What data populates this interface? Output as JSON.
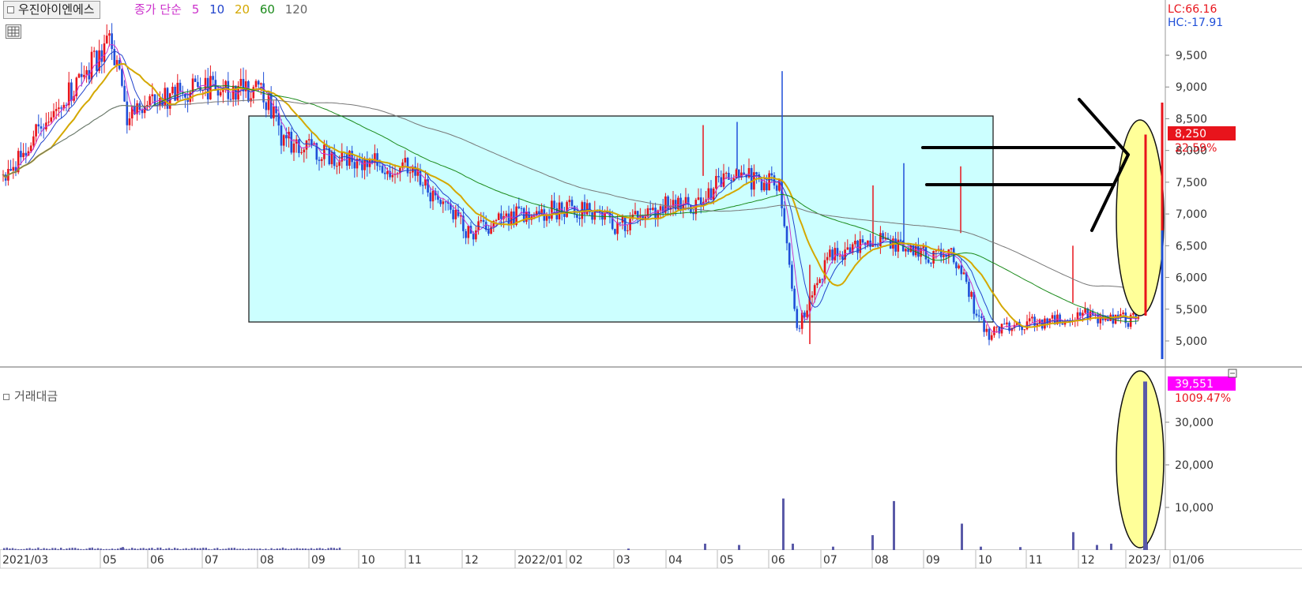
{
  "header": {
    "stock_name": "우진아이엔에스",
    "ma_label": "종가 단순",
    "ma_periods": [
      {
        "label": "5",
        "color": "#cc33cc"
      },
      {
        "label": "10",
        "color": "#2244cc"
      },
      {
        "label": "20",
        "color": "#d4a800"
      },
      {
        "label": "60",
        "color": "#1a8a1a"
      },
      {
        "label": "120",
        "color": "#666666"
      }
    ]
  },
  "price_panel": {
    "lc_label": "LC:66.16",
    "hc_label": "HC:-17.91",
    "current_price": "8,250",
    "change_pct": "22.59%"
  },
  "volume_panel": {
    "title": "거래대금",
    "current_value": "39,551",
    "change_pct": "1009.47%"
  },
  "x_axis_labels": [
    "2021/03",
    "05",
    "06",
    "07",
    "08",
    "09",
    "10",
    "11",
    "12",
    "2022/01",
    "02",
    "03",
    "04",
    "05",
    "06",
    "07",
    "08",
    "09",
    "10",
    "11",
    "12",
    "2023/",
    "01/06"
  ],
  "colors": {
    "up": "#e8141c",
    "down": "#1f4fd8",
    "box_fill": "#ccffff",
    "ellipse_fill": "#ffff99",
    "volume_bar": "#5a5aa8",
    "current_price_bg": "#e8141c",
    "volume_value_bg": "#ff00ff"
  },
  "chart_data": [
    {
      "type": "candlestick",
      "title": "우진아이엔에스",
      "y_ticks": [
        5000,
        5500,
        6000,
        6500,
        7000,
        7500,
        8000,
        8500,
        9000,
        9500
      ],
      "y_tick_labels": [
        "5,000",
        "5,500",
        "6,000",
        "6,500",
        "7,000",
        "7,500",
        "8,000",
        "8,500",
        "9,000",
        "9,500"
      ],
      "ylim": [
        4700,
        10450
      ],
      "series": [
        {
          "name": "종가",
          "points": [
            [
              "2021/03",
              7500
            ],
            [
              "2021/04",
              8700
            ],
            [
              "2021/05",
              9700
            ],
            [
              "2021/05",
              8500
            ],
            [
              "2021/06",
              8800
            ],
            [
              "2021/07",
              9000
            ],
            [
              "2021/08",
              8900
            ],
            [
              "2021/08",
              8200
            ],
            [
              "2021/09",
              8000
            ],
            [
              "2021/10",
              7800
            ],
            [
              "2021/11",
              7700
            ],
            [
              "2021/11",
              7300
            ],
            [
              "2021/12",
              6700
            ],
            [
              "2022/01",
              7000
            ],
            [
              "2022/02",
              7100
            ],
            [
              "2022/03",
              6800
            ],
            [
              "2022/04",
              7200
            ],
            [
              "2022/04",
              7100
            ],
            [
              "2022/05",
              7600
            ],
            [
              "2022/06",
              7500
            ],
            [
              "2022/06",
              5200
            ],
            [
              "2022/07",
              6300
            ],
            [
              "2022/08",
              6600
            ],
            [
              "2022/09",
              6300
            ],
            [
              "2022/09",
              6500
            ],
            [
              "2022/10",
              5100
            ],
            [
              "2022/11",
              5300
            ],
            [
              "2022/12",
              5400
            ],
            [
              "2023/01",
              5300
            ],
            [
              "2023/01/06",
              8250
            ]
          ]
        },
        {
          "name": "5",
          "values": "ma5"
        },
        {
          "name": "10",
          "values": "ma10"
        },
        {
          "name": "20",
          "values": "ma20"
        },
        {
          "name": "60",
          "values": "ma60"
        },
        {
          "name": "120",
          "values": "ma120"
        }
      ]
    },
    {
      "type": "bar",
      "title": "거래대금",
      "y_ticks": [
        10000,
        20000,
        30000
      ],
      "y_tick_labels": [
        "10,000",
        "20,000",
        "30,000"
      ],
      "ylim": [
        0,
        40500
      ],
      "series": [
        {
          "name": "거래대금",
          "points": [
            [
              "2021/04",
              500
            ],
            [
              "2021/05",
              700
            ],
            [
              "2022/03",
              350
            ],
            [
              "2022/04",
              1500
            ],
            [
              "2022/05",
              1200
            ],
            [
              "2022/06",
              12100
            ],
            [
              "2022/06",
              1500
            ],
            [
              "2022/07",
              800
            ],
            [
              "2022/08",
              3500
            ],
            [
              "2022/08",
              11500
            ],
            [
              "2022/09",
              6200
            ],
            [
              "2022/10",
              800
            ],
            [
              "2022/11",
              700
            ],
            [
              "2022/12",
              4200
            ],
            [
              "2022/12",
              1200
            ],
            [
              "2023/01",
              1500
            ],
            [
              "2023/01/06",
              39551
            ]
          ]
        }
      ]
    }
  ]
}
